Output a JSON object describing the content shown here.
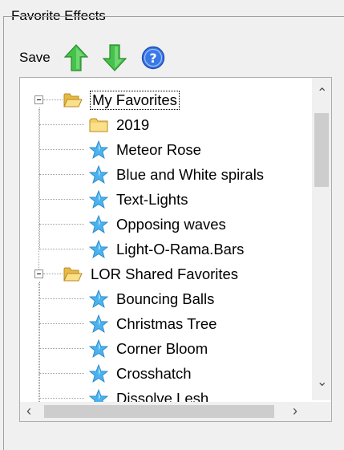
{
  "group": {
    "title": "Favorite Effects"
  },
  "toolbar": {
    "save_label": "Save"
  },
  "tree": {
    "nodes": [
      {
        "label": "My Favorites",
        "type": "folder-open",
        "level": 0,
        "expanded": true,
        "focused": true
      },
      {
        "label": "2019",
        "type": "folder",
        "level": 1
      },
      {
        "label": "Meteor Rose",
        "type": "star",
        "level": 1
      },
      {
        "label": "Blue and White spirals",
        "type": "star",
        "level": 1
      },
      {
        "label": "Text-Lights",
        "type": "star",
        "level": 1
      },
      {
        "label": "Opposing waves",
        "type": "star",
        "level": 1
      },
      {
        "label": "Light-O-Rama.Bars",
        "type": "star",
        "level": 1
      },
      {
        "label": "LOR Shared Favorites",
        "type": "folder-open",
        "level": 0,
        "expanded": true
      },
      {
        "label": "Bouncing Balls",
        "type": "star",
        "level": 1
      },
      {
        "label": "Christmas Tree",
        "type": "star",
        "level": 1
      },
      {
        "label": "Corner Bloom",
        "type": "star",
        "level": 1
      },
      {
        "label": "Crosshatch",
        "type": "star",
        "level": 1
      },
      {
        "label": "Dissolve Lesh",
        "type": "star",
        "level": 1
      }
    ]
  },
  "colors": {
    "arrow_green": "#3cb371",
    "star_blue": "#3aa6e6",
    "folder_yellow": "#f6d16a",
    "help_blue": "#2f6bd8"
  }
}
